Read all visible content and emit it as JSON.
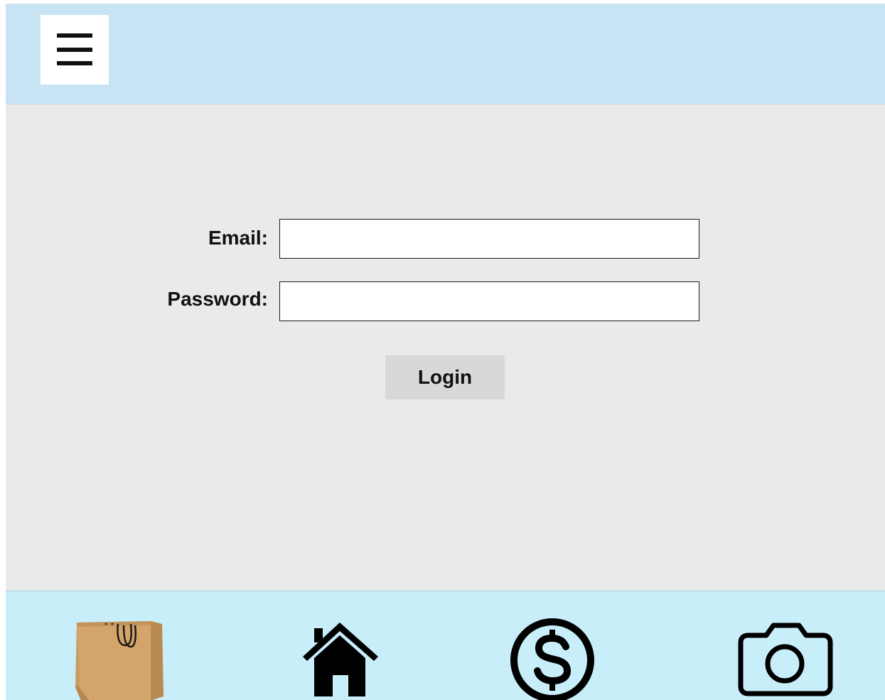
{
  "header": {
    "menu_icon": "hamburger-menu-icon"
  },
  "login_form": {
    "email_label": "Email:",
    "email_value": "",
    "password_label": "Password:",
    "password_value": "",
    "login_label": "Login"
  },
  "bottom_nav": {
    "items": [
      {
        "icon": "shopping-bag-icon"
      },
      {
        "icon": "home-icon"
      },
      {
        "icon": "dollar-icon"
      },
      {
        "icon": "camera-icon"
      }
    ]
  },
  "colors": {
    "header_bg": "#c8e4f5",
    "content_bg": "#eaeaea",
    "nav_bg": "#c8eefa",
    "button_bg": "#d8d8d8"
  }
}
